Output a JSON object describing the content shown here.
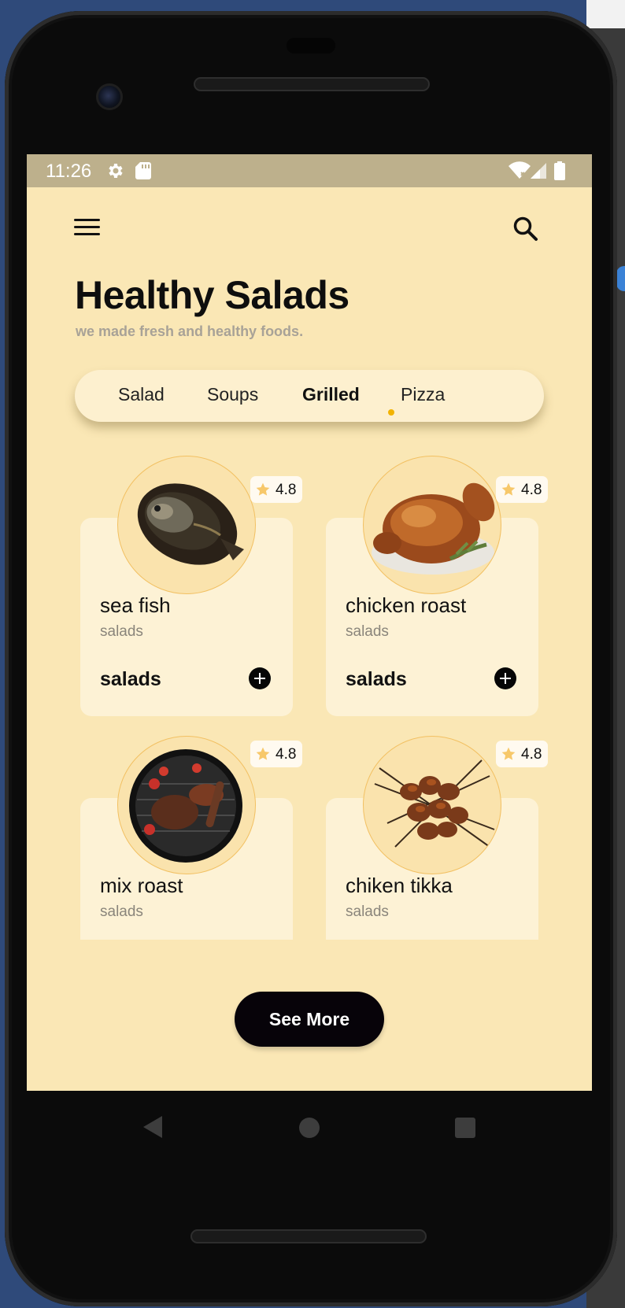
{
  "status_bar": {
    "time": "11:26",
    "icons": [
      "gear-icon",
      "sd-card-icon",
      "wifi-icon",
      "signal-icon",
      "battery-icon"
    ]
  },
  "header": {
    "title": "Healthy Salads",
    "subtitle": "we made fresh and healthy foods."
  },
  "tabs": [
    {
      "label": "Salad",
      "active": false
    },
    {
      "label": "Soups",
      "active": false
    },
    {
      "label": "Grilled",
      "active": true
    },
    {
      "label": "Pizza",
      "active": false
    }
  ],
  "foods": [
    {
      "name": "sea fish",
      "category": "salads",
      "rating": "4.8",
      "price_label": "salads",
      "image_icon": "fish-image"
    },
    {
      "name": "chicken roast",
      "category": "salads",
      "rating": "4.8",
      "price_label": "salads",
      "image_icon": "roast-chicken-image"
    },
    {
      "name": "mix roast",
      "category": "salads",
      "rating": "4.8",
      "image_icon": "grill-platter-image"
    },
    {
      "name": "chiken tikka",
      "category": "salads",
      "rating": "4.8",
      "image_icon": "skewers-image"
    }
  ],
  "see_more_label": "See More",
  "colors": {
    "background": "#fae7b5",
    "status_bar": "#bdb08c",
    "card": "#fdf2d5",
    "accent": "#f2b300",
    "button": "#070309"
  }
}
